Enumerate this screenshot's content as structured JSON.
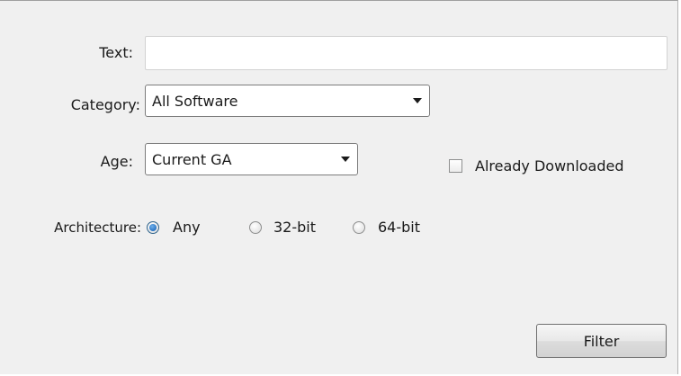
{
  "form": {
    "text_label": "Text:",
    "text_value": "",
    "category_label": "Category:",
    "category_value": "All Software",
    "age_label": "Age:",
    "age_value": "Current GA",
    "already_downloaded_label": "Already Downloaded",
    "already_downloaded_checked": false,
    "architecture_label": "Architecture:",
    "architecture_options": [
      "Any",
      "32-bit",
      "64-bit"
    ],
    "architecture_selected": "Any",
    "filter_button": "Filter"
  }
}
